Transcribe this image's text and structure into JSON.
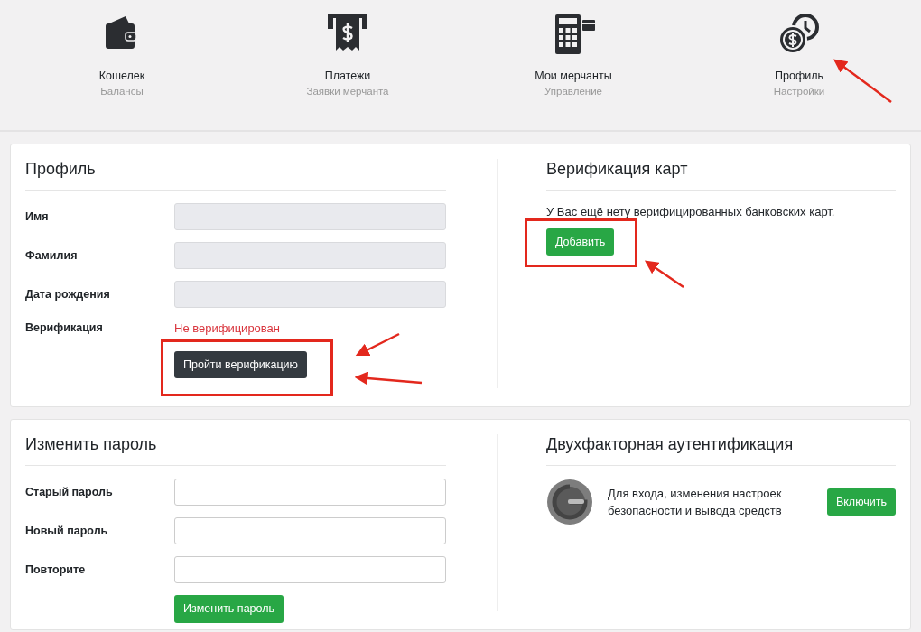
{
  "nav": [
    {
      "title": "Кошелек",
      "subtitle": "Балансы"
    },
    {
      "title": "Платежи",
      "subtitle": "Заявки мерчанта"
    },
    {
      "title": "Мои мерчанты",
      "subtitle": "Управление"
    },
    {
      "title": "Профиль",
      "subtitle": "Настройки"
    }
  ],
  "profile": {
    "title": "Профиль",
    "fields": [
      {
        "label": "Имя",
        "disabled": true
      },
      {
        "label": "Фамилия",
        "disabled": true
      },
      {
        "label": "Дата рождения",
        "disabled": true
      }
    ],
    "verification": {
      "label": "Верификация",
      "status": "Не верифицирован",
      "verified": false,
      "button": "Пройти верификацию"
    }
  },
  "card_verification": {
    "title": "Верификация карт",
    "message": "У Вас ещё нету верифицированных банковских карт.",
    "button": "Добавить"
  },
  "change_password": {
    "title": "Изменить пароль",
    "fields": [
      {
        "label": "Старый пароль",
        "disabled": false
      },
      {
        "label": "Новый пароль",
        "disabled": false
      },
      {
        "label": "Повторите",
        "disabled": false
      }
    ],
    "button": "Изменить пароль"
  },
  "two_factor": {
    "title": "Двухфакторная аутентификация",
    "description": "Для входа, изменения настроек безопасности и вывода средств",
    "button": "Включить"
  }
}
